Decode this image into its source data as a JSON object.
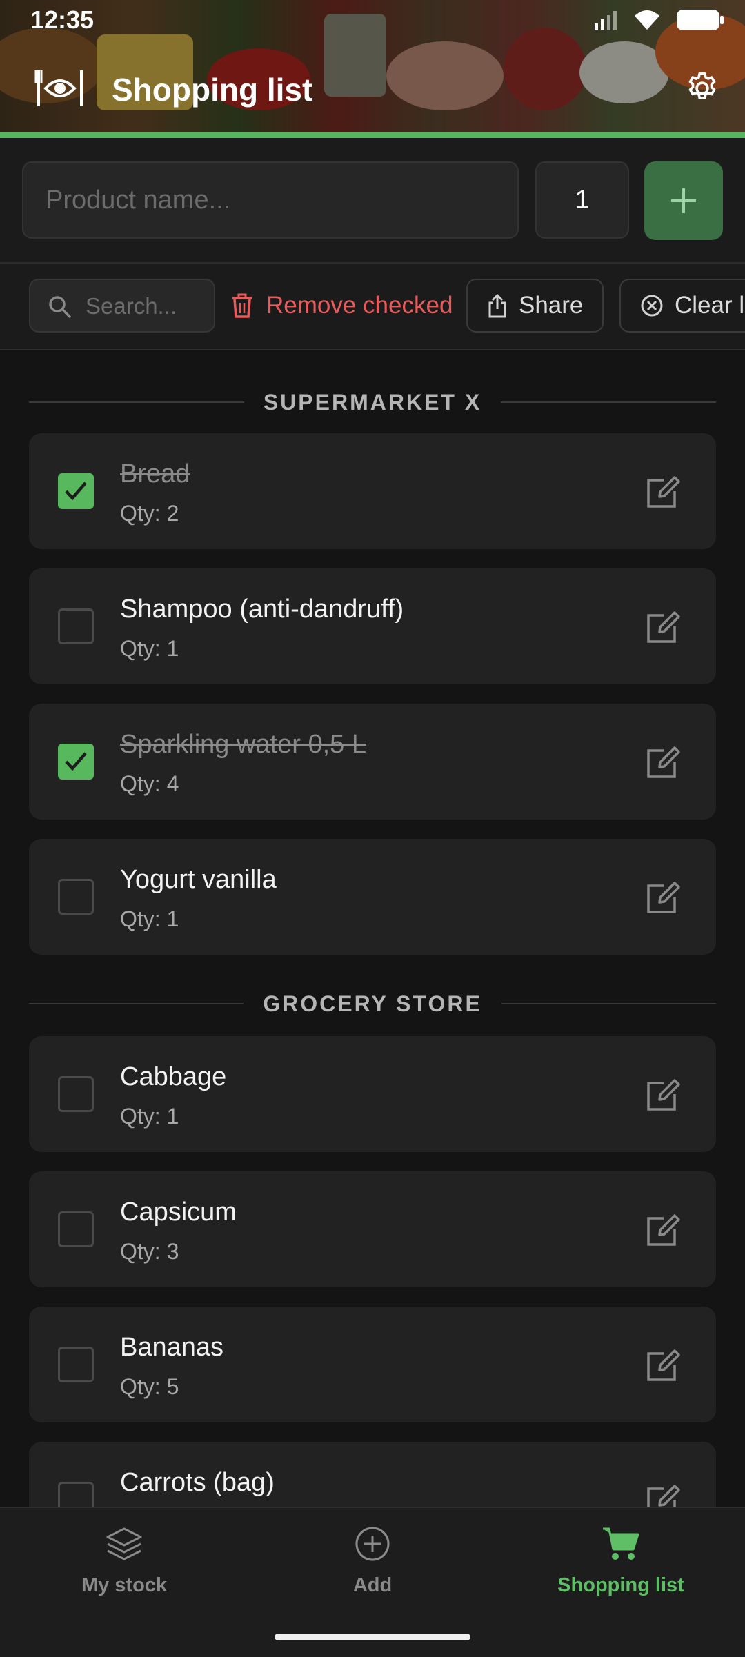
{
  "status_bar": {
    "time": "12:35"
  },
  "header": {
    "title": "Shopping list",
    "accent_color": "#56b660"
  },
  "add_form": {
    "name_placeholder": "Product name...",
    "quantity_value": "1",
    "add_icon": "plus-icon"
  },
  "toolbar": {
    "search_placeholder": "Search...",
    "remove_checked_label": "Remove checked",
    "share_label": "Share",
    "clear_label": "Clear l"
  },
  "sections": [
    {
      "label": "SUPERMARKET X",
      "items": [
        {
          "name": "Bread",
          "qty": "Qty: 2",
          "checked": true
        },
        {
          "name": "Shampoo (anti-dandruff)",
          "qty": "Qty: 1",
          "checked": false
        },
        {
          "name": "Sparkling water 0,5 L",
          "qty": "Qty: 4",
          "checked": true
        },
        {
          "name": "Yogurt vanilla",
          "qty": "Qty: 1",
          "checked": false
        }
      ]
    },
    {
      "label": "GROCERY STORE",
      "items": [
        {
          "name": "Cabbage",
          "qty": "Qty: 1",
          "checked": false
        },
        {
          "name": "Capsicum",
          "qty": "Qty: 3",
          "checked": false
        },
        {
          "name": "Bananas",
          "qty": "Qty: 5",
          "checked": false
        },
        {
          "name": "Carrots (bag)",
          "qty": "",
          "checked": false
        }
      ]
    }
  ],
  "bottom_nav": [
    {
      "label": "My stock",
      "icon": "layers-icon",
      "active": false
    },
    {
      "label": "Add",
      "icon": "add-circle-icon",
      "active": false
    },
    {
      "label": "Shopping list",
      "icon": "cart-icon",
      "active": true
    }
  ],
  "colors": {
    "checked": "#58b85e",
    "danger": "#ea5a5a",
    "active_nav": "#5fbf67",
    "add_button": "#3a6e43"
  }
}
